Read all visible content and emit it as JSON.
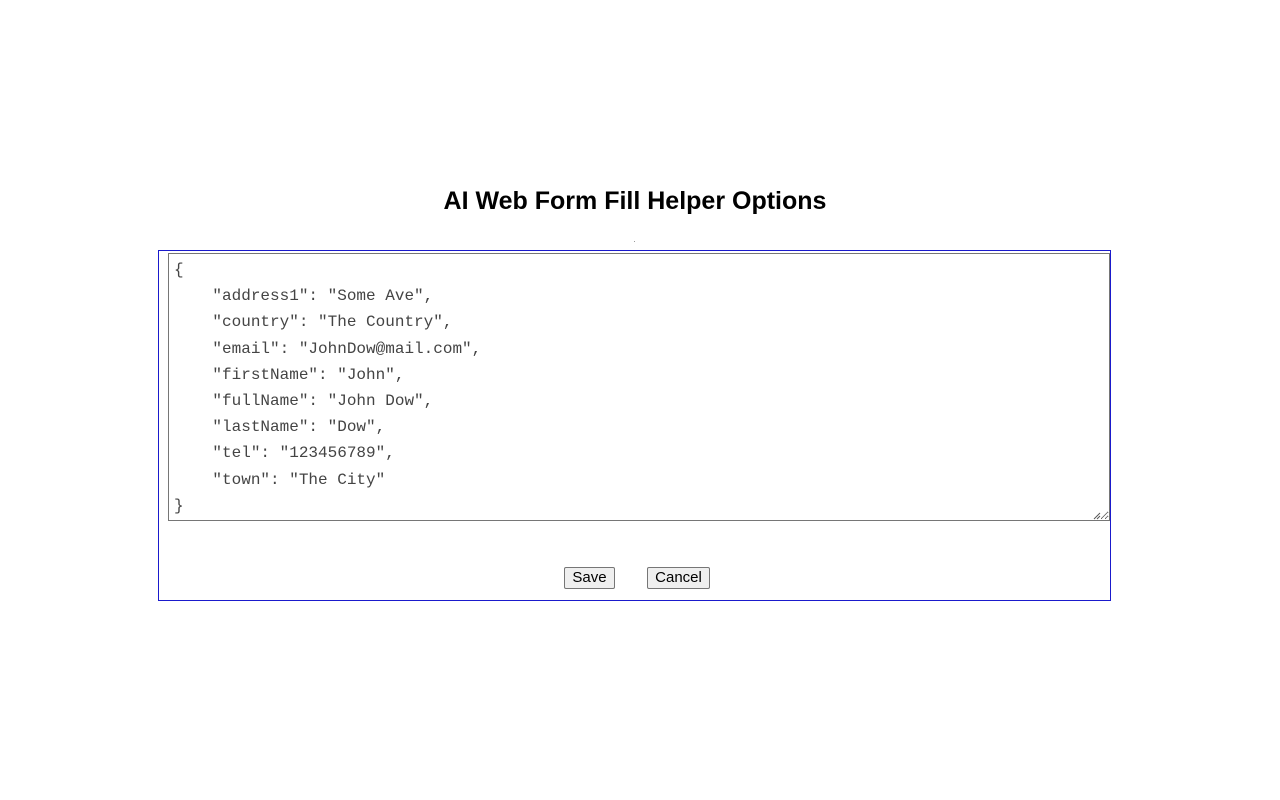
{
  "page": {
    "title": "AI Web Form Fill Helper Options"
  },
  "editor": {
    "value": "{\n    \"address1\": \"Some Ave\",\n    \"country\": \"The Country\",\n    \"email\": \"JohnDow@mail.com\",\n    \"firstName\": \"John\",\n    \"fullName\": \"John Dow\",\n    \"lastName\": \"Dow\",\n    \"tel\": \"123456789\",\n    \"town\": \"The City\"\n}"
  },
  "actions": {
    "save_label": "Save",
    "cancel_label": "Cancel"
  },
  "colors": {
    "panel_border": "#1a1acc",
    "text": "#000000"
  },
  "icons": {
    "resize": "resize-grip-icon"
  }
}
